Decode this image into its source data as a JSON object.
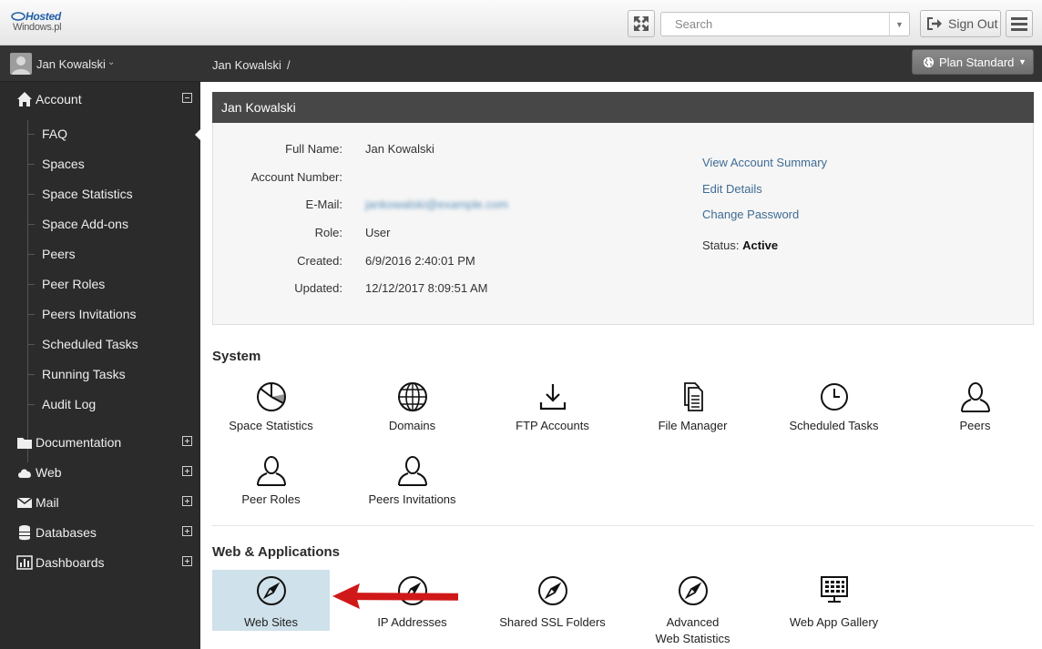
{
  "logo": {
    "line1": "Hosted",
    "line2": "Windows.pl"
  },
  "topbar": {
    "search_placeholder": "Search",
    "signout_label": "Sign Out"
  },
  "sidebar": {
    "user_name": "Jan Kowalski",
    "account_label": "Account",
    "account_items": [
      "FAQ",
      "Spaces",
      "Space Statistics",
      "Space Add-ons",
      "Peers",
      "Peer Roles",
      "Peers Invitations",
      "Scheduled Tasks",
      "Running Tasks",
      "Audit Log"
    ],
    "groups": [
      "Documentation",
      "Web",
      "Mail",
      "Databases",
      "Dashboards"
    ]
  },
  "breadcrumb": {
    "item": "Jan Kowalski",
    "separator": "/"
  },
  "plan_button": {
    "label": "Plan Standard"
  },
  "account_panel": {
    "title": "Jan Kowalski",
    "fields": [
      {
        "label": "Full Name:",
        "value": "Jan Kowalski"
      },
      {
        "label": "Account Number:",
        "value": ""
      },
      {
        "label": "E-Mail:",
        "value": "jankowalski@example.com"
      },
      {
        "label": "Role:",
        "value": "User"
      },
      {
        "label": "Created:",
        "value": "6/9/2016 2:40:01 PM"
      },
      {
        "label": "Updated:",
        "value": "12/12/2017 8:09:51 AM"
      }
    ],
    "links": [
      "View Account Summary",
      "Edit Details",
      "Change Password"
    ],
    "status_label": "Status:",
    "status_value": "Active"
  },
  "system": {
    "title": "System",
    "tiles": [
      "Space Statistics",
      "Domains",
      "FTP Accounts",
      "File Manager",
      "Scheduled Tasks",
      "Peers",
      "Peer Roles",
      "Peers Invitations"
    ]
  },
  "web_apps": {
    "title": "Web & Applications",
    "tiles": [
      "Web Sites",
      "IP Addresses",
      "Shared SSL Folders",
      "Advanced Web Statistics",
      "Web App Gallery"
    ],
    "selected_tile": "Web Sites"
  },
  "colors": {
    "accent_link": "#3f6c93",
    "selected_tile": "#cfe1ea",
    "arrow": "#d01818",
    "sidebar_bg": "#2b2b2b"
  }
}
